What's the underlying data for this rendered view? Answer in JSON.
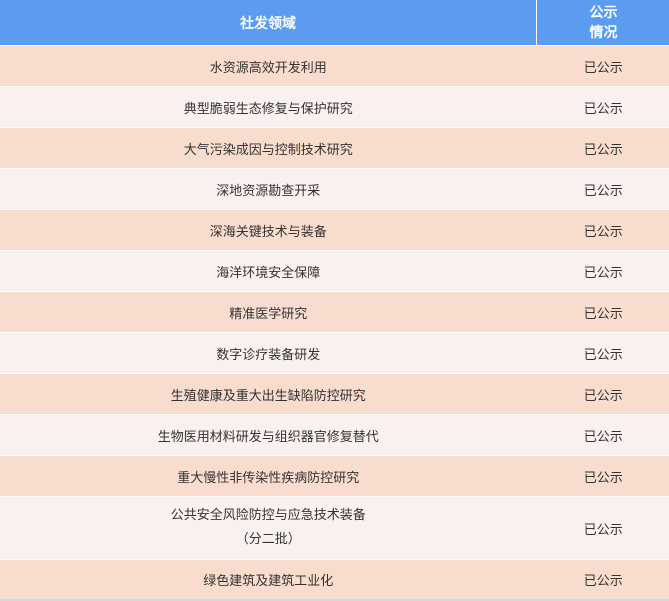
{
  "header": {
    "field": "社发领域",
    "status_line1": "公示",
    "status_line2": "情况"
  },
  "rows": [
    {
      "field": "水资源高效开发利用",
      "status": "已公示"
    },
    {
      "field": "典型脆弱生态修复与保护研究",
      "status": "已公示"
    },
    {
      "field": "大气污染成因与控制技术研究",
      "status": "已公示"
    },
    {
      "field": "深地资源勘查开采",
      "status": "已公示"
    },
    {
      "field": "深海关键技术与装备",
      "status": "已公示"
    },
    {
      "field": "海洋环境安全保障",
      "status": "已公示"
    },
    {
      "field": "精准医学研究",
      "status": "已公示"
    },
    {
      "field": "数字诊疗装备研发",
      "status": "已公示"
    },
    {
      "field": "生殖健康及重大出生缺陷防控研究",
      "status": "已公示"
    },
    {
      "field": "生物医用材料研发与组织器官修复替代",
      "status": "已公示"
    },
    {
      "field": "重大慢性非传染性疾病防控研究",
      "status": "已公示"
    },
    {
      "field": "公共安全风险防控与应急技术装备",
      "field_line2": "（分二批）",
      "status": "已公示"
    },
    {
      "field": "绿色建筑及建筑工业化",
      "status": "已公示"
    }
  ]
}
